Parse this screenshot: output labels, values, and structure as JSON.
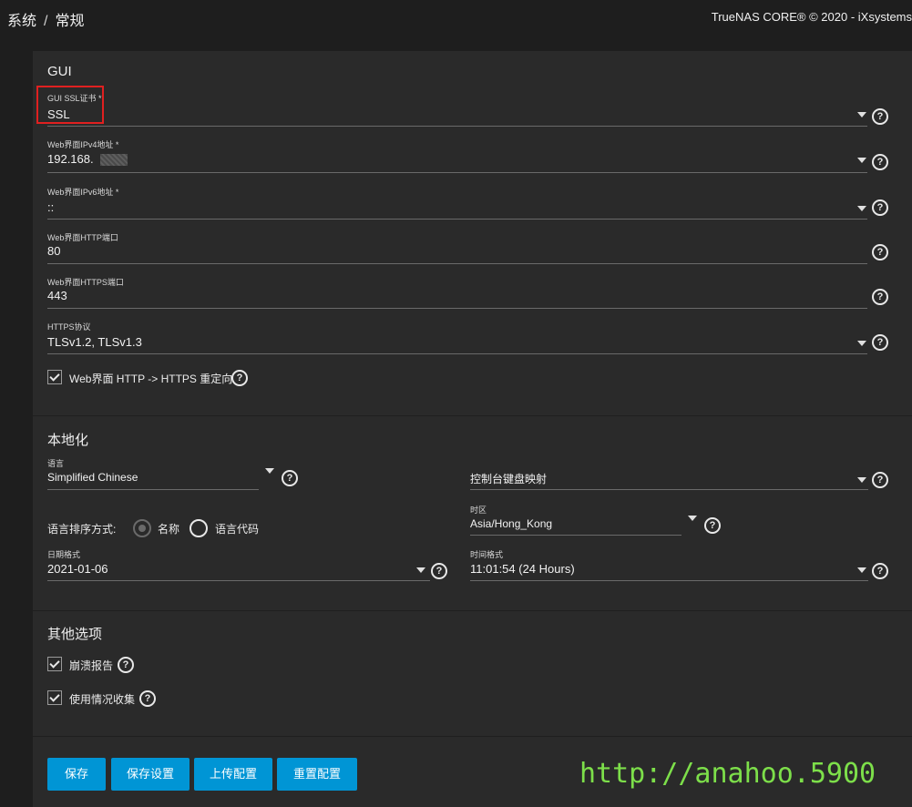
{
  "breadcrumb": {
    "part1": "系统",
    "separator": "/",
    "part2": "常规"
  },
  "copyright": "TrueNAS CORE® © 2020 - iXsystems",
  "gui": {
    "section_title": "GUI",
    "ssl_cert": {
      "label": "GUI SSL证书 *",
      "value": "SSL"
    },
    "ipv4": {
      "label": "Web界面IPv4地址 *",
      "value": "192.168."
    },
    "ipv6": {
      "label": "Web界面IPv6地址 *",
      "value": "::"
    },
    "http_port": {
      "label": "Web界面HTTP端口",
      "value": "80"
    },
    "https_port": {
      "label": "Web界面HTTPS端口",
      "value": "443"
    },
    "https_protocol": {
      "label": "HTTPS协议",
      "value": "TLSv1.2, TLSv1.3"
    },
    "redirect": {
      "label": "Web界面 HTTP -> HTTPS 重定向",
      "checked": true
    }
  },
  "localization": {
    "section_title": "本地化",
    "language": {
      "label": "语言",
      "value": "Simplified Chinese"
    },
    "console_keymap": {
      "label": "",
      "value": "控制台键盘映射"
    },
    "sort": {
      "label": "语言排序方式:",
      "option_name": "名称",
      "option_code": "语言代码",
      "selected": "名称"
    },
    "timezone": {
      "label": "时区",
      "value": "Asia/Hong_Kong"
    },
    "date_format": {
      "label": "日期格式",
      "value": "2021-01-06"
    },
    "time_format": {
      "label": "时间格式",
      "value": "11:01:54 (24 Hours)"
    }
  },
  "other": {
    "section_title": "其他选项",
    "crash_report": {
      "label": "崩溃报告",
      "checked": true
    },
    "usage_collection": {
      "label": "使用情况收集",
      "checked": true
    }
  },
  "buttons": {
    "save": "保存",
    "save_config": "保存设置",
    "upload_config": "上传配置",
    "reset_config": "重置配置"
  },
  "watermark": "http://anahoo.5900",
  "colors": {
    "accent": "#0095d5",
    "background": "#1e1e1e",
    "card": "#2a2a2a",
    "highlight": "#e02020",
    "watermark": "#7ddf4a"
  },
  "icons": {
    "help": "question-circle-icon",
    "dropdown": "caret-down-icon",
    "check": "checkmark-icon"
  }
}
